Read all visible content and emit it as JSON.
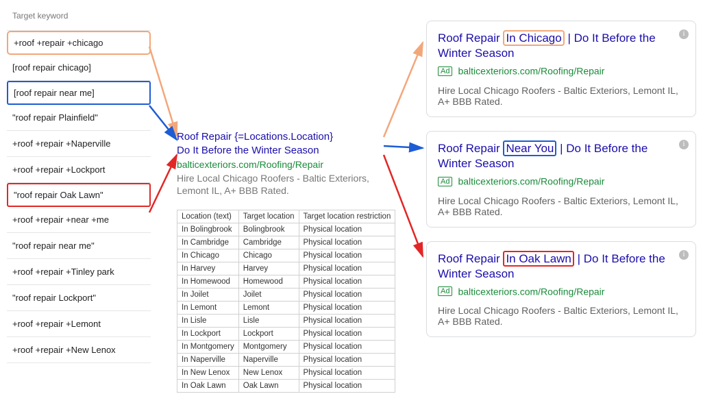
{
  "keyword_header": "Target keyword",
  "keywords": [
    {
      "text": "+roof +repair +chicago",
      "hl": "orange"
    },
    {
      "text": "[roof repair chicago]"
    },
    {
      "text": "[roof repair near me]",
      "hl": "blue"
    },
    {
      "text": "\"roof repair Plainfield\""
    },
    {
      "text": "+roof +repair +Naperville"
    },
    {
      "text": "+roof +repair +Lockport"
    },
    {
      "text": "\"roof repair Oak Lawn\"",
      "hl": "red"
    },
    {
      "text": "+roof +repair +near +me"
    },
    {
      "text": "\"roof repair near me\""
    },
    {
      "text": "+roof +repair +Tinley park"
    },
    {
      "text": "\"roof repair Lockport\""
    },
    {
      "text": "+roof +repair +Lemont"
    },
    {
      "text": "+roof +repair +New Lenox"
    }
  ],
  "template_ad": {
    "line1": "Roof Repair {=Locations.Location}",
    "line2": "Do It Before the Winter Season",
    "url": "balticexteriors.com/Roofing/Repair",
    "desc": "Hire Local Chicago Roofers - Baltic Exteriors, Lemont IL, A+ BBB Rated."
  },
  "loc_table": {
    "headers": [
      "Location (text)",
      "Target location",
      "Target location restriction"
    ],
    "rows": [
      [
        "In Bolingbrook",
        "Bolingbrook",
        "Physical location"
      ],
      [
        "In Cambridge",
        "Cambridge",
        "Physical location"
      ],
      [
        "In Chicago",
        "Chicago",
        "Physical location"
      ],
      [
        "In Harvey",
        "Harvey",
        "Physical location"
      ],
      [
        "In Homewood",
        "Homewood",
        "Physical location"
      ],
      [
        "In Joilet",
        "Joilet",
        "Physical location"
      ],
      [
        "In Lemont",
        "Lemont",
        "Physical location"
      ],
      [
        "In Lisle",
        "Lisle",
        "Physical location"
      ],
      [
        "In Lockport",
        "Lockport",
        "Physical location"
      ],
      [
        "In Montgomery",
        "Montgomery",
        "Physical location"
      ],
      [
        "In Naperville",
        "Naperville",
        "Physical location"
      ],
      [
        "In New Lenox",
        "New Lenox",
        "Physical location"
      ],
      [
        "In Oak Lawn",
        "Oak Lawn",
        "Physical location"
      ]
    ]
  },
  "ad_badge": "Ad",
  "ad_url": "balticexteriors.com/Roofing/Repair",
  "ad_desc": "Hire Local Chicago Roofers - Baltic Exteriors, Lemont IL, A+ BBB Rated.",
  "ads": [
    {
      "prefix": "Roof Repair ",
      "hl": "In Chicago",
      "hl_class": "orange",
      "suffix": "| Do It Before the Winter Season"
    },
    {
      "prefix": "Roof Repair ",
      "hl": "Near You",
      "hl_class": "blue",
      "suffix": "| Do It Before the Winter Season"
    },
    {
      "prefix": "Roof Repair ",
      "hl": "In Oak Lawn",
      "hl_class": "red",
      "suffix": "| Do It Before the Winter Season"
    }
  ]
}
